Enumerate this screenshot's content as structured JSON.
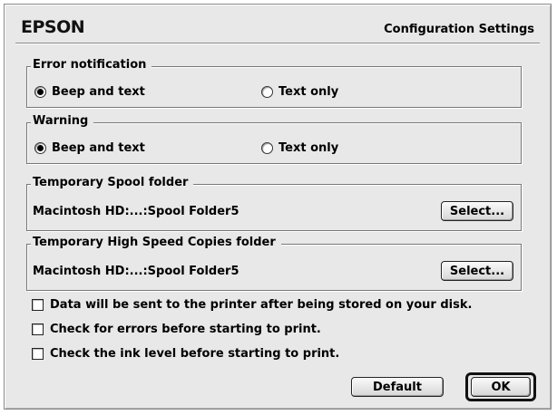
{
  "header": {
    "logo": "EPSON",
    "title": "Configuration Settings"
  },
  "error_notification": {
    "legend": "Error notification",
    "options": [
      {
        "label": "Beep and text",
        "selected": true
      },
      {
        "label": "Text only",
        "selected": false
      }
    ]
  },
  "warning": {
    "legend": "Warning",
    "options": [
      {
        "label": "Beep and text",
        "selected": true
      },
      {
        "label": "Text only",
        "selected": false
      }
    ]
  },
  "spool_folder": {
    "legend": "Temporary Spool folder",
    "path": "Macintosh HD:...:Spool Folder5",
    "button": "Select..."
  },
  "copies_folder": {
    "legend": "Temporary High Speed Copies folder",
    "path": "Macintosh HD:...:Spool Folder5",
    "button": "Select..."
  },
  "options": [
    {
      "label": "Data will be sent to the printer after being stored on your disk.",
      "checked": false
    },
    {
      "label": "Check for errors before starting to print.",
      "checked": false
    },
    {
      "label": "Check the ink level before starting to print.",
      "checked": false
    }
  ],
  "buttons": {
    "default": "Default",
    "ok": "OK"
  }
}
